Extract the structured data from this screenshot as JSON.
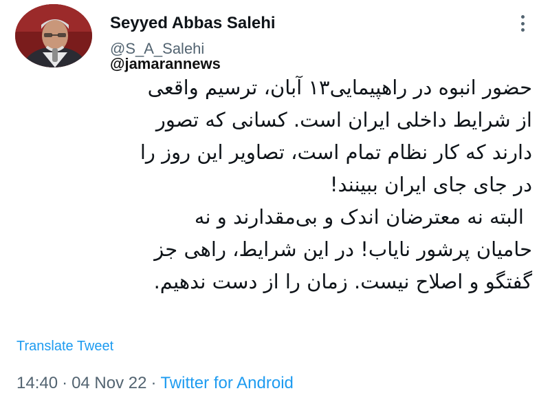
{
  "author": {
    "name": "Seyyed Abbas Salehi",
    "handle": "@S_A_Salehi",
    "avatar": "profile-photo"
  },
  "watermark": "@jamarannews",
  "tweet": {
    "lines": [
      "حضور انبوه در راهپیمایی۱۳ آبان، ترسیم واقعی",
      "از شرایط داخلی ایران است. کسانی که تصور",
      "دارند که کار نظام تمام است، تصاویر این روز را",
      "در جای جای ایران ببینند!",
      "البته نه معترضان اندک و بی‌مقدارند و نه",
      "حامیان پرشور نایاب! در این شرایط، راهی جز",
      "گفتگو و اصلاح نیست. زمان را از دست ندهیم."
    ]
  },
  "translate_label": "Translate Tweet",
  "meta": {
    "time": "14:40",
    "separator": "·",
    "date": "04 Nov 22",
    "source": "Twitter for Android"
  },
  "colors": {
    "link": "#1d9bf0",
    "secondary": "#536471",
    "text": "#0f1419"
  }
}
